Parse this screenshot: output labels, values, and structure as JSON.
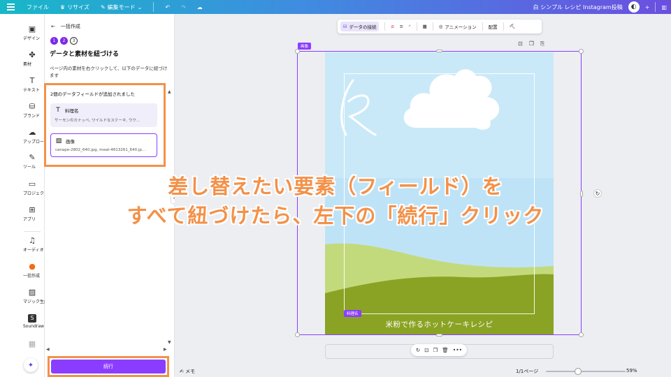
{
  "topbar": {
    "file": "ファイル",
    "resize": "リサイズ",
    "edit_mode": "編集モード",
    "doc_title": "白 シンプル レシピ Instagram投稿"
  },
  "rail": {
    "items": [
      {
        "label": "デザイン",
        "icon": "▣"
      },
      {
        "label": "素材",
        "icon": "✤"
      },
      {
        "label": "テキスト",
        "icon": "T"
      },
      {
        "label": "ブランド",
        "icon": "⛁"
      },
      {
        "label": "アップロード",
        "icon": "☁"
      },
      {
        "label": "ツール",
        "icon": "✎"
      },
      {
        "label": "プロジェクト",
        "icon": "▭"
      },
      {
        "label": "アプリ",
        "icon": "⊞"
      },
      {
        "label": "オーディオ",
        "icon": "♫"
      },
      {
        "label": "一括作成",
        "icon": "●"
      },
      {
        "label": "マジック生成",
        "icon": "▨"
      },
      {
        "label": "Soundraw",
        "icon": "S"
      },
      {
        "label": "",
        "icon": "▦"
      }
    ]
  },
  "panel": {
    "back_label": "一括作成",
    "steps": [
      "1",
      "2",
      "3"
    ],
    "title": "データと素材を紐づける",
    "description": "ページ内の素材を右クリックして、以下のデータに紐づけます",
    "field_count": "2個のデータフィールドが追加されました",
    "fields": [
      {
        "title": "料理名",
        "icon": "T",
        "sample": "サーモンのカナッペ, ワイルドなステーキ, ウク..."
      },
      {
        "title": "画像",
        "icon": "▨",
        "sample": "canape-2802_640.jpg, meat-4813261_640.jp..."
      }
    ],
    "continue_label": "続行"
  },
  "toolbar": {
    "data_link": "データの接続",
    "animation": "アニメーション",
    "position": "配置"
  },
  "canvas": {
    "frame_tag": "画像",
    "page_label": "料理名",
    "page_title": "米粉で作るホットケーキレシピ",
    "sky_color": "#bfe3f6",
    "grass_light": "#c3da7c",
    "grass_dark": "#8aa324",
    "accent": "#8b3dff"
  },
  "bottombar": {
    "memo": "メモ",
    "page_count": "1/1ページ",
    "zoom": "59%"
  },
  "annotation": {
    "line1": "差し替えたい要素（フィールド）を",
    "line2": "すべて紐づけたら、左下の「続行」クリック",
    "color": "#f39149"
  }
}
